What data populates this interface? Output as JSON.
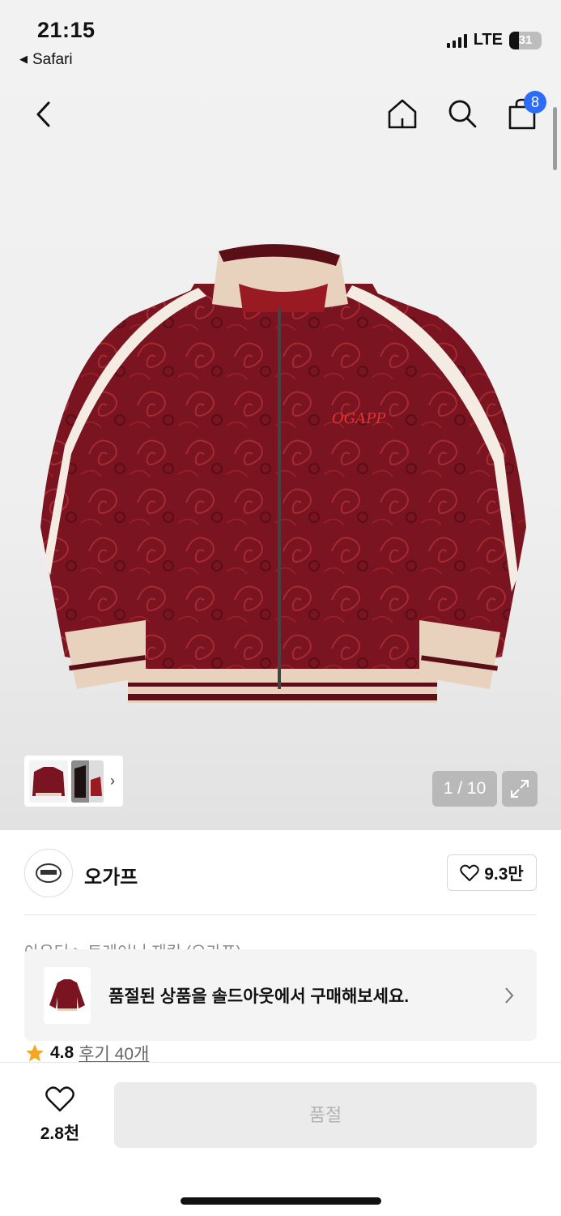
{
  "status_bar": {
    "time": "21:15",
    "back_app": "Safari",
    "network": "LTE",
    "battery": "31"
  },
  "nav": {
    "icons": [
      "back-icon",
      "home-icon",
      "search-icon",
      "shopping-bag-icon"
    ],
    "cart_count": "8"
  },
  "gallery": {
    "counter": "1 / 10",
    "product_colors": {
      "body": "#7a1420",
      "trim": "#e8d2bd",
      "stripe": "#f4ece2"
    }
  },
  "brand": {
    "name": "오가프",
    "likes": "9.3만"
  },
  "product": {
    "breadcrumb": "아우터 > 트레이닝 재킷 (오가프)",
    "rating": "4.8",
    "reviews": "후기 40개"
  },
  "banner": {
    "text": "품절된 상품을 솔드아웃에서 구매해보세요."
  },
  "bottom": {
    "wish_count": "2.8천",
    "buy_label": "품절"
  },
  "colors": {
    "accent": "#2d6cf6",
    "star": "#f5a623"
  }
}
